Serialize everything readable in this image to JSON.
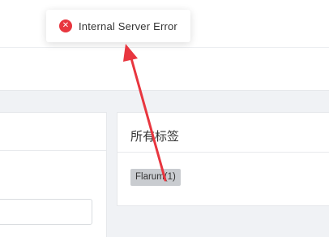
{
  "toast": {
    "icon": "error-x-icon",
    "message": "Internal Server Error",
    "accent_color": "#e8363f"
  },
  "tags_panel": {
    "title": "所有标签",
    "tags": [
      {
        "label": "Flarum(1)"
      }
    ]
  },
  "annotation": {
    "arrow_color": "#e8363f"
  }
}
